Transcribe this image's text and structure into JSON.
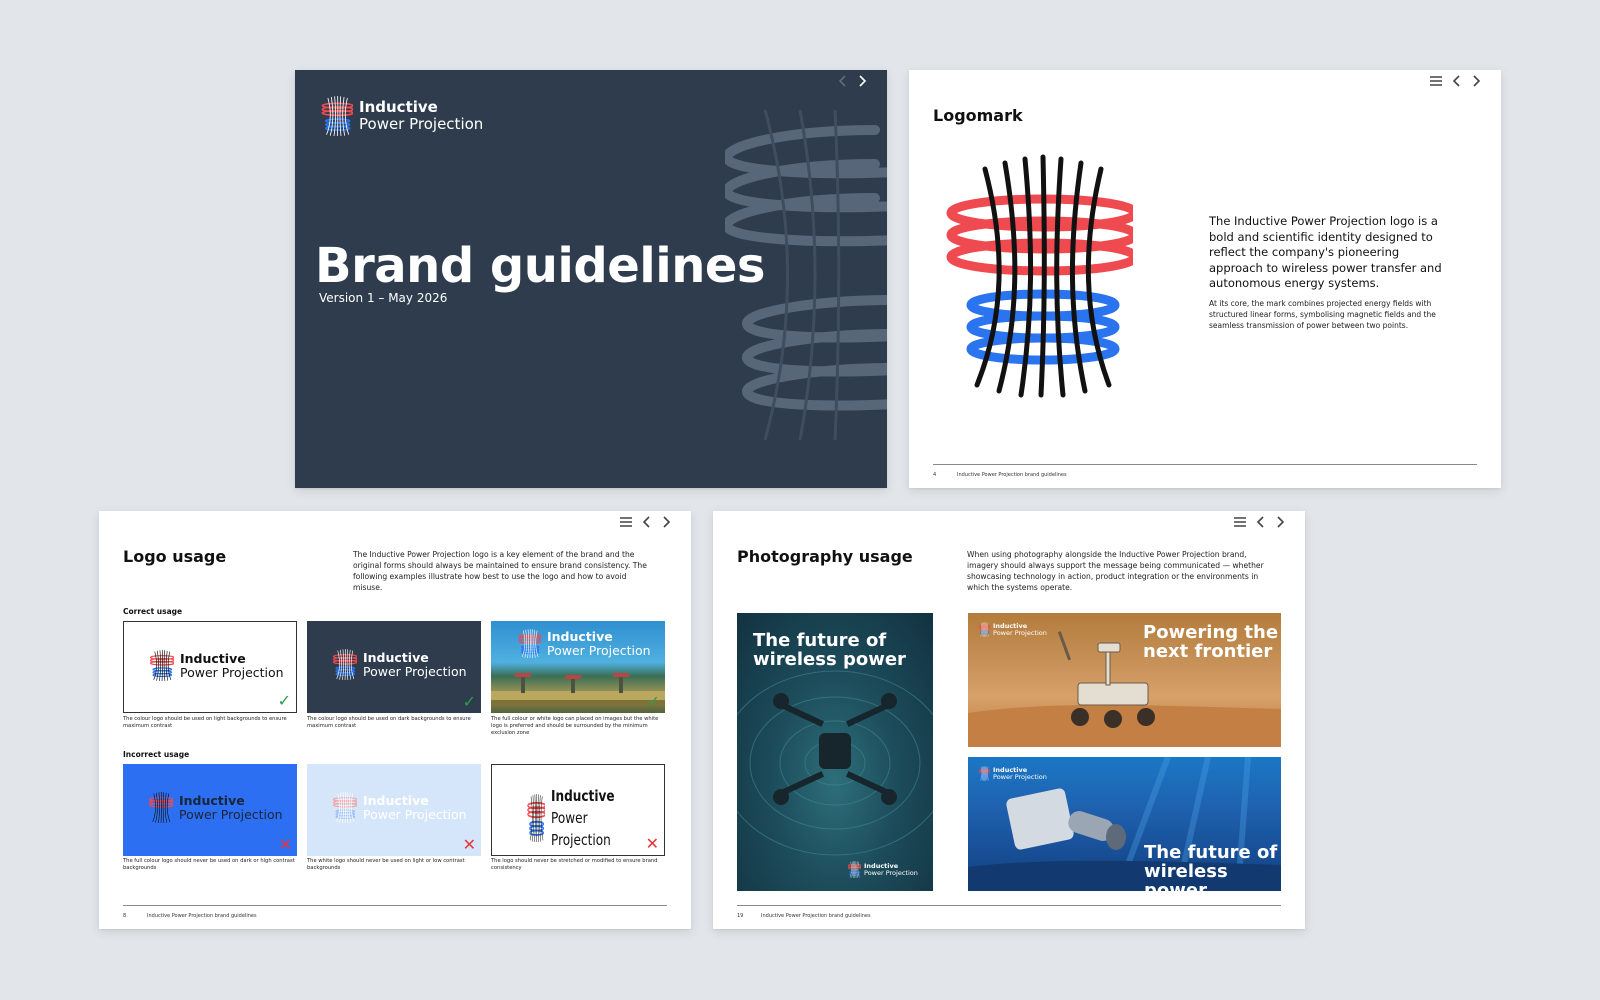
{
  "brand": {
    "line1": "Inductive",
    "line2": "Power Projection",
    "red": "#ef4a4f",
    "blue": "#2b74f0",
    "navy": "#2e3c4e"
  },
  "nav_icons": [
    "menu-icon",
    "chevron-left-icon",
    "chevron-right-icon"
  ],
  "cover": {
    "title": "Brand guidelines",
    "version": "Version 1 – May 2026"
  },
  "logomark": {
    "title": "Logomark",
    "lead": "The Inductive Power Projection logo is a bold and scientific identity designed to reflect the company's pioneering approach to wireless power transfer and autonomous energy systems.",
    "detail": "At its core, the mark combines projected energy fields with structured linear forms, symbolising magnetic fields and the seamless transmission of power between two points.",
    "page": "4",
    "footer": "Inductive Power Projection brand guidelines"
  },
  "logo_usage": {
    "title": "Logo usage",
    "description": "The Inductive Power Projection logo is a key element of the brand and the original forms should always be maintained to ensure brand consistency. The following examples illustrate how best to use the logo and how to avoid misuse.",
    "correct_label": "Correct usage",
    "incorrect_label": "Incorrect usage",
    "correct": [
      {
        "caption": "The colour logo should be used on light backgrounds to ensure maximum contrast",
        "mark": "✓"
      },
      {
        "caption": "The colour logo should be used on dark backgrounds to ensure maximum contrast",
        "mark": "✓"
      },
      {
        "caption": "The full colour or white logo can placed on images but the white logo is preferred and should be surrounded by the minimum exclusion zone",
        "mark": "✓"
      }
    ],
    "incorrect": [
      {
        "caption": "The full colour logo should never be used on dark or high contrast backgrounds",
        "mark": "✕"
      },
      {
        "caption": "The white logo should never be used on light or low contrast backgrounds",
        "mark": "✕"
      },
      {
        "caption": "The logo should never be stretched or modified to ensure brand consistency",
        "mark": "✕"
      }
    ],
    "page": "8",
    "footer": "Inductive Power Projection brand guidelines"
  },
  "photo_usage": {
    "title": "Photography usage",
    "description": "When using photography alongside the Inductive Power Projection brand, imagery should always support the message being communicated — whether showcasing technology in action, product integration or the environments in which the systems operate.",
    "photos": [
      {
        "headline_1": "The future of",
        "headline_2": "wireless power"
      },
      {
        "headline_1": "Powering the",
        "headline_2": "next frontier"
      },
      {
        "headline_1": "The future of",
        "headline_2": "wireless power"
      }
    ],
    "page": "19",
    "footer": "Inductive Power Projection brand guidelines"
  }
}
